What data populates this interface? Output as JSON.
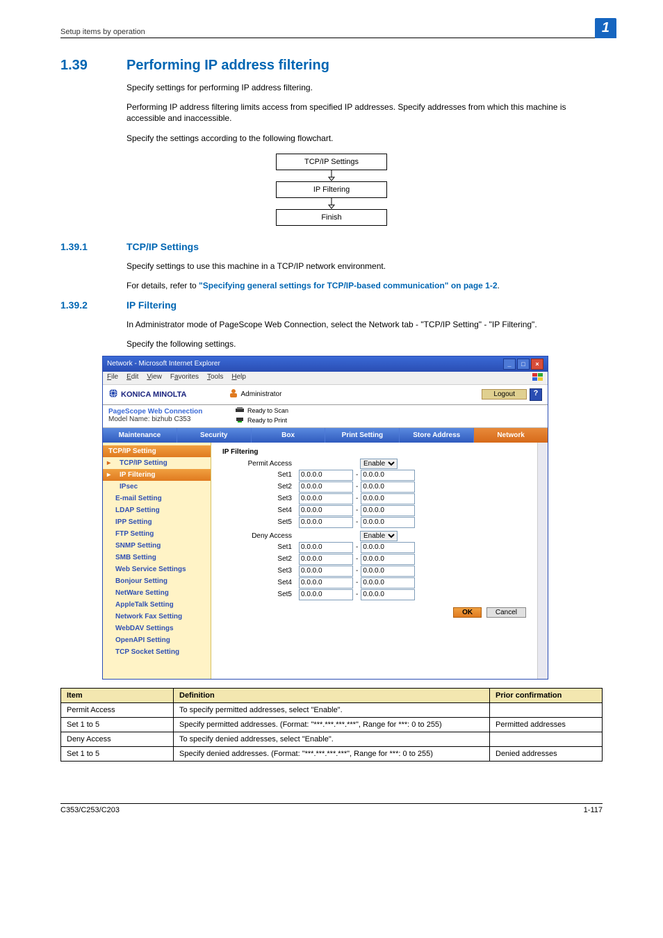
{
  "header": {
    "breadcrumb": "Setup items by operation",
    "chip": "1"
  },
  "section": {
    "num": "1.39",
    "title": "Performing IP address filtering",
    "p1": "Specify settings for performing IP address filtering.",
    "p2": "Performing IP address filtering limits access from specified IP addresses. Specify addresses from which this machine is accessible and inaccessible.",
    "p3": "Specify the settings according to the following flowchart."
  },
  "flow": [
    "TCP/IP Settings",
    "IP Filtering",
    "Finish"
  ],
  "sub1": {
    "num": "1.39.1",
    "title": "TCP/IP Settings",
    "p1": "Specify settings to use this machine in a TCP/IP network environment.",
    "p2_prefix": "For details, refer to ",
    "p2_link": "\"Specifying general settings for TCP/IP-based communication\" on page 1-2",
    "p2_suffix": "."
  },
  "sub2": {
    "num": "1.39.2",
    "title": "IP Filtering",
    "p1": "In Administrator mode of PageScope Web Connection, select the Network tab - \"TCP/IP Setting\" - \"IP Filtering\".",
    "p2": "Specify the following settings."
  },
  "win": {
    "title": "Network - Microsoft Internet Explorer",
    "menus": [
      "File",
      "Edit",
      "View",
      "Favorites",
      "Tools",
      "Help"
    ],
    "brand": "KONICA MINOLTA",
    "admin_label": "Administrator",
    "logout": "Logout",
    "help": "?",
    "pagescope": "PageScope Web Connection",
    "model": "Model Name: bizhub C353",
    "ready_scan": "Ready to Scan",
    "ready_print": "Ready to Print",
    "tabs": [
      "Maintenance",
      "Security",
      "Box",
      "Print Setting",
      "Store Address",
      "Network"
    ],
    "active_tab": 5,
    "side_head": "TCP/IP Setting",
    "side_items": [
      {
        "label": "TCP/IP Setting",
        "sub": true,
        "cur": true,
        "sel": false
      },
      {
        "label": "IP Filtering",
        "sub": true,
        "cur": true,
        "sel": true
      },
      {
        "label": "IPsec",
        "sub": true,
        "cur": false,
        "sel": false
      },
      {
        "label": "E-mail Setting",
        "cur": false
      },
      {
        "label": "LDAP Setting",
        "cur": false
      },
      {
        "label": "IPP Setting",
        "cur": false
      },
      {
        "label": "FTP Setting",
        "cur": false
      },
      {
        "label": "SNMP Setting",
        "cur": false
      },
      {
        "label": "SMB Setting",
        "cur": false
      },
      {
        "label": "Web Service Settings",
        "cur": false
      },
      {
        "label": "Bonjour Setting",
        "cur": false
      },
      {
        "label": "NetWare Setting",
        "cur": false
      },
      {
        "label": "AppleTalk Setting",
        "cur": false
      },
      {
        "label": "Network Fax Setting",
        "cur": false
      },
      {
        "label": "WebDAV Settings",
        "cur": false
      },
      {
        "label": "OpenAPI Setting",
        "cur": false
      },
      {
        "label": "TCP Socket Setting",
        "cur": false
      }
    ],
    "content": {
      "heading": "IP Filtering",
      "permit_label": "Permit Access",
      "deny_label": "Deny Access",
      "enable_option": "Enable",
      "sets": [
        {
          "label": "Set1",
          "a": "0.0.0.0",
          "b": "0.0.0.0"
        },
        {
          "label": "Set2",
          "a": "0.0.0.0",
          "b": "0.0.0.0"
        },
        {
          "label": "Set3",
          "a": "0.0.0.0",
          "b": "0.0.0.0"
        },
        {
          "label": "Set4",
          "a": "0.0.0.0",
          "b": "0.0.0.0"
        },
        {
          "label": "Set5",
          "a": "0.0.0.0",
          "b": "0.0.0.0"
        }
      ],
      "ok": "OK",
      "cancel": "Cancel"
    }
  },
  "def_table": {
    "headers": [
      "Item",
      "Definition",
      "Prior confirmation"
    ],
    "rows": [
      [
        "Permit Access",
        "To specify permitted addresses, select \"Enable\".",
        ""
      ],
      [
        "Set 1 to 5",
        "Specify permitted addresses. (Format: \"***.***.***.***\", Range for ***: 0 to 255)",
        "Permitted addresses"
      ],
      [
        "Deny Access",
        "To specify denied addresses, select \"Enable\".",
        ""
      ],
      [
        "Set 1 to 5",
        "Specify denied addresses. (Format: \"***.***.***.***\", Range for ***: 0 to 255)",
        "Denied addresses"
      ]
    ]
  },
  "footer": {
    "left": "C353/C253/C203",
    "right": "1-117"
  }
}
